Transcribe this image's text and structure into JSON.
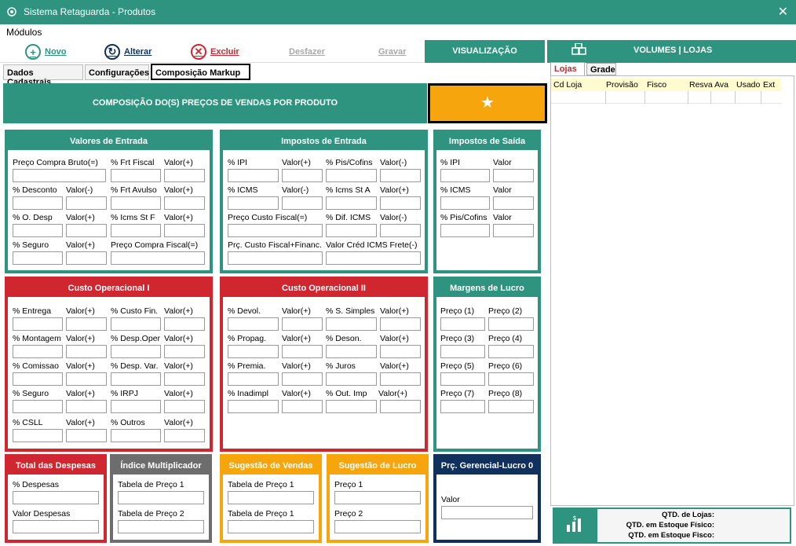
{
  "window": {
    "title": "Sistema Retaguarda - Produtos",
    "close_glyph": "✕"
  },
  "menu": {
    "modulos": "Módulos"
  },
  "toolbar": {
    "novo": "Novo",
    "alterar": "Alterar",
    "excluir": "Excluir",
    "desfazer": "Desfazer",
    "gravar": "Gravar",
    "visualizacao": "VISUALIZAÇÃO",
    "volumes_lojas": "VOLUMES | LOJAS"
  },
  "tabs": [
    "Dados Cadastrais",
    "Configurações",
    "Composição Markup"
  ],
  "header": {
    "title": "COMPOSIÇÃO DO(S) PREÇOS DE VENDAS POR PRODUTO",
    "star": "★"
  },
  "groups": {
    "valores_entrada": {
      "title": "Valores de Entrada",
      "labels": [
        "Preço Compra Bruto(=)",
        "% Frt Fiscal",
        "Valor(+)",
        "% Desconto",
        "Valor(-)",
        "% Frt Avulso",
        "Valor(+)",
        "% O. Desp",
        "Valor(+)",
        "% Icms St F",
        "Valor(+)",
        "% Seguro",
        "Valor(+)",
        "Preço Compra Fiscal(=)"
      ]
    },
    "impostos_entrada": {
      "title": "Impostos de Entrada",
      "labels": [
        "% IPI",
        "Valor(+)",
        "% Pis/Cofins",
        "Valor(-)",
        "% ICMS",
        "Valor(-)",
        "% Icms St A",
        "Valor(+)",
        "Preço Custo Fiscal(=)",
        "% Dif. ICMS",
        "Valor(-)",
        "Prç. Custo Fiscal+Financ.",
        "Valor Créd ICMS Frete(-)"
      ]
    },
    "impostos_saida": {
      "title": "Impostos de Saída",
      "labels": [
        "% IPI",
        "Valor",
        "% ICMS",
        "Valor",
        "% Pis/Cofins",
        "Valor"
      ]
    },
    "custo_op1": {
      "title": "Custo Operacional I",
      "labels": [
        "% Entrega",
        "Valor(+)",
        "% Custo Fin.",
        "Valor(+)",
        "% Montagem",
        "Valor(+)",
        "% Desp.Oper",
        "Valor(+)",
        "% Comissao",
        "Valor(+)",
        "% Desp. Var.",
        "Valor(+)",
        "% Seguro",
        "Valor(+)",
        "% IRPJ",
        "Valor(+)",
        "% CSLL",
        "Valor(+)",
        "% Outros",
        "Valor(+)"
      ]
    },
    "custo_op2": {
      "title": "Custo Operacional II",
      "labels": [
        "% Devol.",
        "Valor(+)",
        "% S. Simples",
        "Valor(+)",
        "% Propag.",
        "Valor(+)",
        "% Deson.",
        "Valor(+)",
        "% Premia.",
        "Valor(+)",
        "% Juros",
        "Valor(+)",
        "% Inadimpl",
        "Valor(+)",
        "% Out. Imp",
        "Valor(+)"
      ]
    },
    "margens": {
      "title": "Margens de Lucro",
      "labels": [
        "Preço (1)",
        "Preço (2)",
        "Preço (3)",
        "Preço (4)",
        "Preço (5)",
        "Preço (6)",
        "Preço (7)",
        "Preço (8)"
      ]
    },
    "total_despesas": {
      "title": "Total das Despesas",
      "labels": [
        "% Despesas",
        "Valor Despesas"
      ]
    },
    "indice_mult": {
      "title": "Índice Multiplicador",
      "labels": [
        "Tabela de Preço 1",
        "Tabela de Preço 2"
      ]
    },
    "sugestao_vendas": {
      "title": "Sugestão de Vendas",
      "labels": [
        "Tabela de Preço 1",
        "Tabela de Preço 1"
      ]
    },
    "sugestao_lucro": {
      "title": "Sugestão de Lucro",
      "labels": [
        "Preço 1",
        "Preço 2"
      ]
    },
    "prc_gerencial": {
      "title": "Prç. Gerencial-Lucro 0",
      "labels": [
        "Valor"
      ]
    }
  },
  "right": {
    "tabs": [
      "Lojas",
      "Grade"
    ],
    "columns": [
      "Cd Loja",
      "Provisão",
      "Fisco",
      "Resva Ava",
      "Usado",
      "Ext"
    ],
    "stock": [
      "QTD. de Lojas:",
      "QTD. em Estoque Físico:",
      "QTD. em Estoque Fisco:"
    ]
  },
  "colors": {
    "teal": "#2e9480",
    "red": "#d0262f",
    "gray": "#6d6d6d",
    "orange": "#f6a50c",
    "navy": "#10305d"
  },
  "icons": [
    "app-icon",
    "plus-circle-icon",
    "refresh-circle-icon",
    "x-circle-icon",
    "star-icon",
    "boxes-icon",
    "stock-chart-icon"
  ]
}
